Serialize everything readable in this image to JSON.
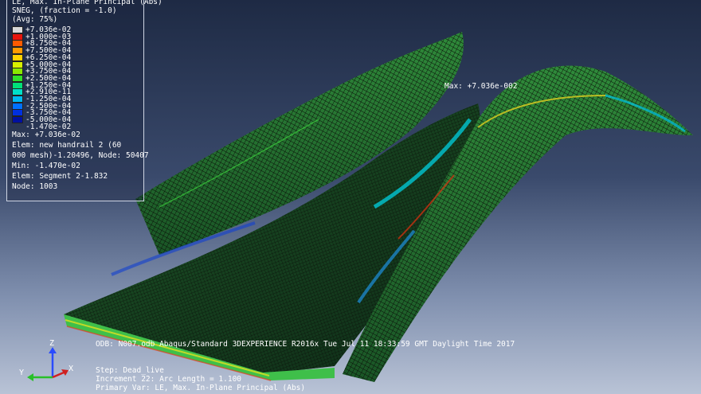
{
  "legend": {
    "header_lines": [
      "LE, Max. In-Plane Principal (Abs)",
      "SNEG, (fraction = -1.0)",
      "(Avg: 75%)"
    ],
    "contour": [
      {
        "label": "+7.036e-02",
        "color": "#d8d8d8"
      },
      {
        "label": "+1.000e-03",
        "color": "#e8140b"
      },
      {
        "label": "+8.750e-04",
        "color": "#ff5a00"
      },
      {
        "label": "+7.500e-04",
        "color": "#ff9a00"
      },
      {
        "label": "+6.250e-04",
        "color": "#ffd200"
      },
      {
        "label": "+5.000e-04",
        "color": "#d8f000"
      },
      {
        "label": "+3.750e-04",
        "color": "#8ae800"
      },
      {
        "label": "+2.500e-04",
        "color": "#2fe02a"
      },
      {
        "label": "+1.250e-04",
        "color": "#00e07a"
      },
      {
        "label": "+2.910e-11",
        "color": "#00e0c8"
      },
      {
        "label": "-1.250e-04",
        "color": "#00b8f0"
      },
      {
        "label": "-2.500e-04",
        "color": "#0070ff"
      },
      {
        "label": "-3.750e-04",
        "color": "#0030e0"
      },
      {
        "label": "-5.000e-04",
        "color": "#0010a0"
      },
      {
        "label": "-1.470e-02",
        "color": ""
      }
    ],
    "max_lines": [
      "Max: +7.036e-02",
      "  Elem: new handrail 2 (60",
      "000 mesh)-1.20496,  Node: 50407"
    ],
    "min_lines": [
      "Min: -1.470e-02",
      "  Elem: Segment 2-1.832",
      "  Node: 1003"
    ]
  },
  "max_marker": "Max: +7.036e-002",
  "footer": {
    "odb_line": "ODB: N007.odb    Abaqus/Standard 3DEXPERIENCE R2016x   Tue Jul 11 18:33:59 GMT Daylight Time 2017",
    "step": "Step: Dead_live",
    "increment": "Increment    22: Arc Length =    1.100",
    "primary_var": "Primary Var: LE, Max. In-Plane Principal (Abs)"
  },
  "triad": {
    "x": "X",
    "y": "Y",
    "z": "Z"
  }
}
